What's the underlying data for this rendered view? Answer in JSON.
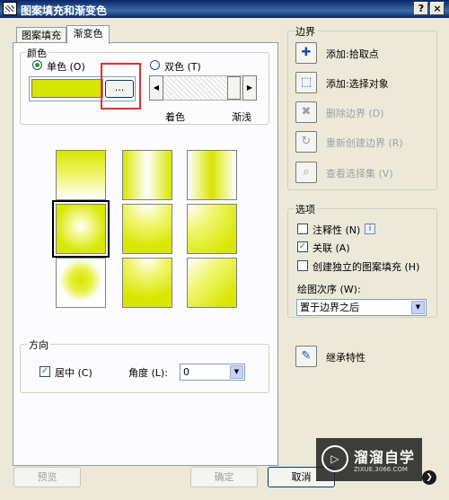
{
  "window": {
    "title": "图案填充和渐变色",
    "help": "?",
    "close": "×"
  },
  "tabs": [
    {
      "label": "图案填充"
    },
    {
      "label": "渐变色"
    }
  ],
  "color_group": {
    "label": "颜色",
    "single": "单色",
    "single_key": "(O)",
    "double": "双色",
    "double_key": "(T)",
    "swatch_color": "#d8e600",
    "browse": "...",
    "shade_label": "着色",
    "tint_label": "渐浅"
  },
  "gradient_cells": [
    {
      "pattern": "linear"
    },
    {
      "pattern": "cylinder"
    },
    {
      "pattern": "inv-cylinder"
    },
    {
      "pattern": "spherical"
    },
    {
      "pattern": "hemispherical"
    },
    {
      "pattern": "curved"
    },
    {
      "pattern": "inv-spherical"
    },
    {
      "pattern": "inv-hemispherical"
    },
    {
      "pattern": "inv-curved"
    }
  ],
  "direction_group": {
    "label": "方向",
    "centered": "居中",
    "centered_key": "(C)",
    "angle": "角度",
    "angle_key": "(L):",
    "angle_value": "0"
  },
  "boundary_group": {
    "label": "边界",
    "items": [
      {
        "label": "添加:拾取点",
        "icon": "pick-points-icon",
        "enabled": true
      },
      {
        "label": "添加:选择对象",
        "icon": "select-objects-icon",
        "enabled": true
      },
      {
        "label": "删除边界",
        "key": "(D)",
        "icon": "remove-boundaries-icon",
        "enabled": false
      },
      {
        "label": "重新创建边界",
        "key": "(R)",
        "icon": "recreate-boundary-icon",
        "enabled": false
      },
      {
        "label": "查看选择集",
        "key": "(V)",
        "icon": "view-selections-icon",
        "enabled": false
      }
    ]
  },
  "options_group": {
    "label": "选项",
    "annotative": "注释性",
    "annotative_key": "(N)",
    "info": "i",
    "associative": "关联",
    "associative_key": "(A)",
    "separate": "创建独立的图案填充",
    "separate_key": "(H)",
    "draw_order_label": "绘图次序",
    "draw_order_key": "(W):",
    "draw_order_value": "置于边界之后"
  },
  "inherit": {
    "label": "继承特性"
  },
  "buttons": {
    "preview": "预览",
    "ok": "确定",
    "cancel": "取消"
  },
  "watermark": {
    "logo": "▷",
    "text": "溜溜自学",
    "sub": "ZIXUE.3066.COM"
  }
}
